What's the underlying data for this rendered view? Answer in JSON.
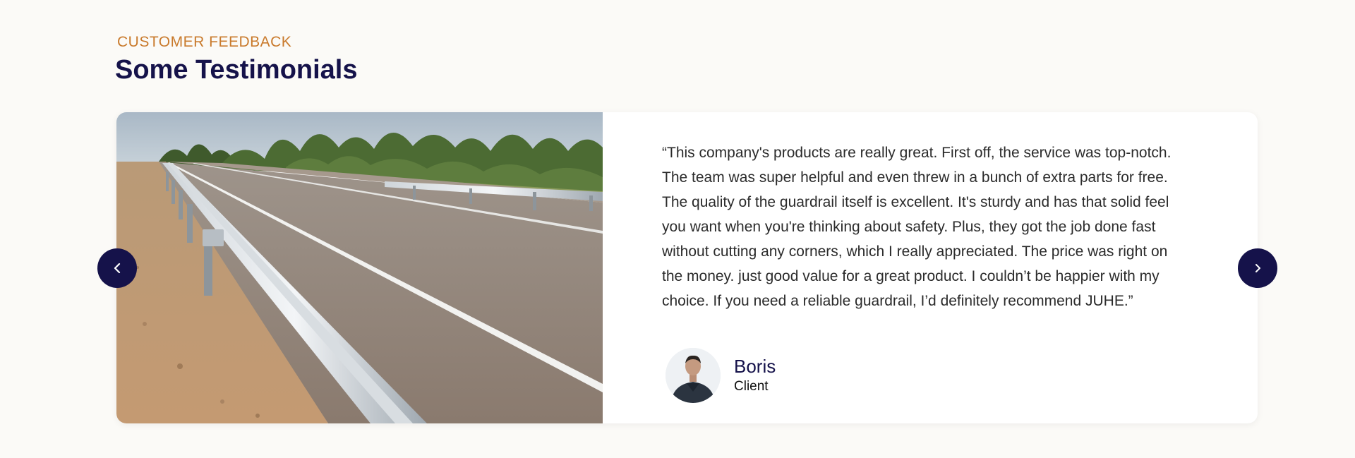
{
  "section": {
    "eyebrow": "CUSTOMER FEEDBACK",
    "title": "Some Testimonials"
  },
  "testimonial": {
    "quote": "“This company's products are really great. First off, the service was top-notch. The team was super helpful and even threw in a bunch of extra parts for free. The quality of the guardrail itself is excellent. It's sturdy and has that solid feel you want when you're thinking about safety. Plus, they got the job done fast without cutting any corners, which I really appreciated. The price was right on the money. just good value for a great product. I couldn’t be happier with my choice. If you need a reliable guardrail, I’d definitely recommend JUHE.”",
    "author_name": "Boris",
    "author_role": "Client"
  },
  "carousel": {
    "prev_icon": "chevron-left-icon",
    "next_icon": "chevron-right-icon"
  },
  "colors": {
    "accent": "#c97a2c",
    "brand_navy": "#15124a",
    "background": "#fbfaf7",
    "card": "#ffffff"
  }
}
